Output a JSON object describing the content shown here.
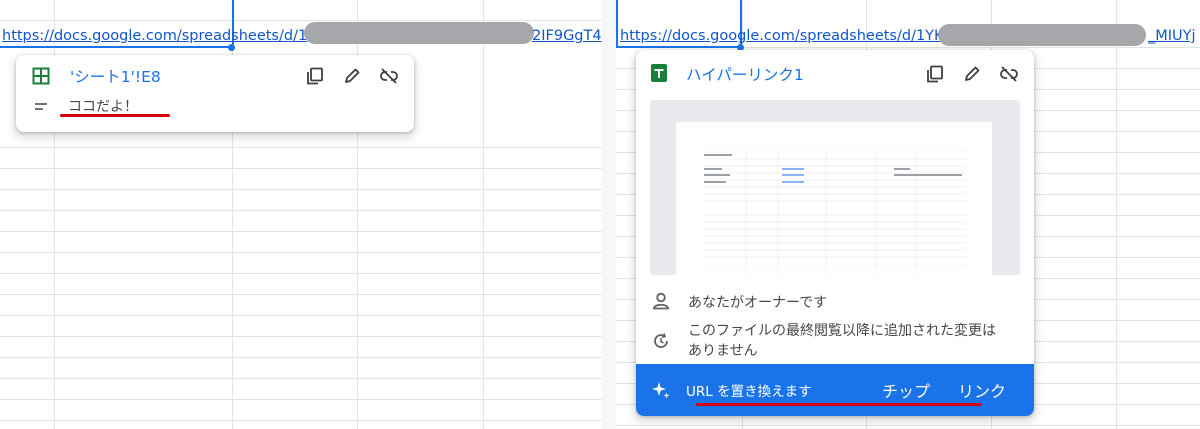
{
  "left_panel": {
    "url_text": "https://docs.google.com/spreadsheets/d/1",
    "url_tail": "2IF9GgT4",
    "chip": {
      "title": "'シート1'!E8",
      "note_text": "ココだよ！",
      "icons": [
        "sheets-grid-icon",
        "copy-icon",
        "edit-pencil-icon",
        "unlink-icon",
        "note-lines-icon"
      ]
    }
  },
  "right_panel": {
    "url_text": "https://docs.google.com/spreadsheets/d/1YK",
    "url_tail": "_MIUYj",
    "chip": {
      "title": "ハイパーリンク1",
      "owner_text": "あなたがオーナーです",
      "changes_line1": "このファイルの最終閲覧以降に追加された変更は",
      "changes_line2": "ありません",
      "footer": {
        "replace_url_label": "URL を置き換えます",
        "chip_label": "チップ",
        "link_label": "リンク"
      },
      "icons": [
        "google-sheets-icon",
        "copy-icon",
        "edit-pencil-icon",
        "unlink-icon",
        "person-icon",
        "history-icon",
        "sparkle-icon"
      ]
    }
  },
  "colors": {
    "accent": "#1a73e8",
    "link": "#1155cc",
    "highlight_underline": "#d9000d",
    "sheets_green": "#188038"
  }
}
